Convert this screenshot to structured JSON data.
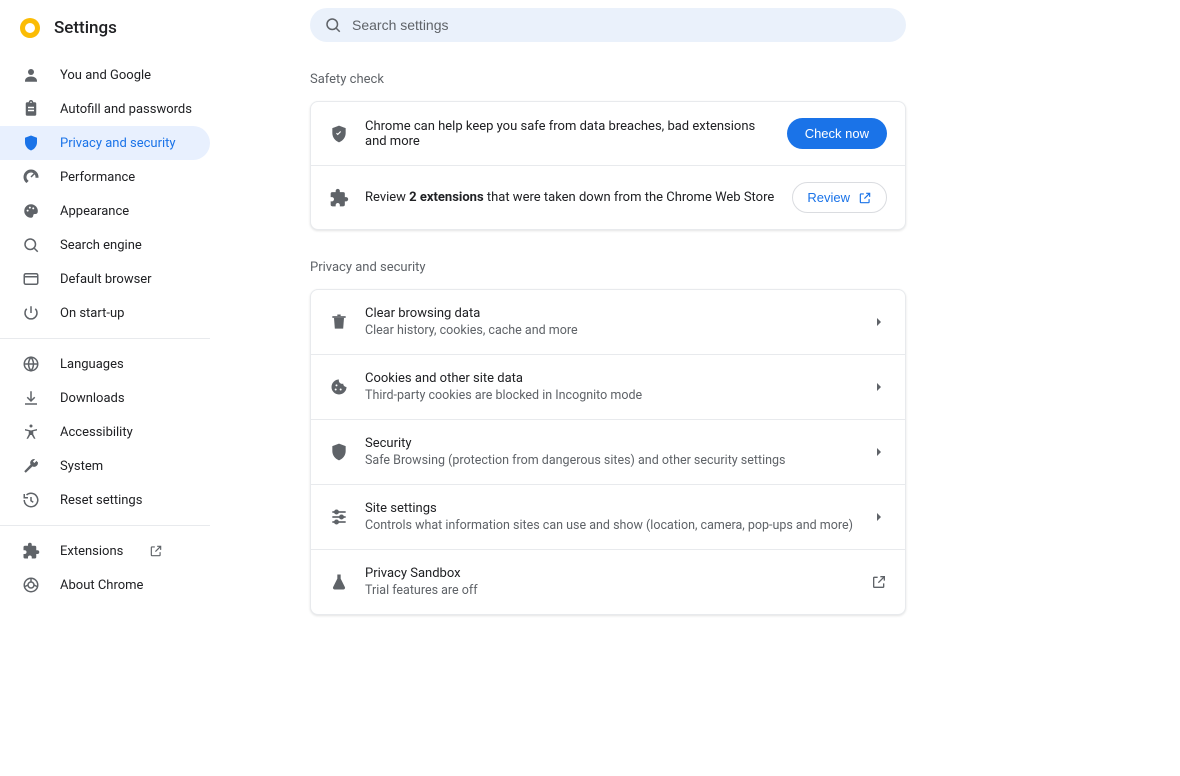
{
  "header": {
    "title": "Settings",
    "search_placeholder": "Search settings"
  },
  "sidebar": {
    "groups": [
      [
        {
          "id": "you",
          "label": "You and Google",
          "icon": "person-icon"
        },
        {
          "id": "autofill",
          "label": "Autofill and passwords",
          "icon": "assignment-icon"
        },
        {
          "id": "privacy",
          "label": "Privacy and security",
          "icon": "shield-icon",
          "active": true
        },
        {
          "id": "performance",
          "label": "Performance",
          "icon": "speed-icon"
        },
        {
          "id": "appearance",
          "label": "Appearance",
          "icon": "palette-icon"
        },
        {
          "id": "search",
          "label": "Search engine",
          "icon": "search-icon"
        },
        {
          "id": "defaultbrowser",
          "label": "Default browser",
          "icon": "window-icon"
        },
        {
          "id": "startup",
          "label": "On start-up",
          "icon": "power-icon"
        }
      ],
      [
        {
          "id": "languages",
          "label": "Languages",
          "icon": "globe-icon"
        },
        {
          "id": "downloads",
          "label": "Downloads",
          "icon": "download-icon"
        },
        {
          "id": "accessibility",
          "label": "Accessibility",
          "icon": "accessibility-icon"
        },
        {
          "id": "system",
          "label": "System",
          "icon": "wrench-icon"
        },
        {
          "id": "reset",
          "label": "Reset settings",
          "icon": "history-icon"
        }
      ],
      [
        {
          "id": "extensions",
          "label": "Extensions",
          "icon": "puzzle-icon",
          "external": true
        },
        {
          "id": "about",
          "label": "About Chrome",
          "icon": "chrome-icon"
        }
      ]
    ]
  },
  "safety_check": {
    "heading": "Safety check",
    "row1_text": "Chrome can help keep you safe from data breaches, bad extensions and more",
    "row1_button": "Check now",
    "row2_prefix": "Review ",
    "row2_bold": "2 extensions",
    "row2_suffix": " that were taken down from the Chrome Web Store",
    "row2_button": "Review"
  },
  "privacy_section": {
    "heading": "Privacy and security",
    "items": [
      {
        "id": "clear",
        "title": "Clear browsing data",
        "sub": "Clear history, cookies, cache and more",
        "icon": "trash-icon",
        "action": "arrow"
      },
      {
        "id": "cookies",
        "title": "Cookies and other site data",
        "sub": "Third-party cookies are blocked in Incognito mode",
        "icon": "cookie-icon",
        "action": "arrow"
      },
      {
        "id": "security",
        "title": "Security",
        "sub": "Safe Browsing (protection from dangerous sites) and other security settings",
        "icon": "shield-icon",
        "action": "arrow"
      },
      {
        "id": "site",
        "title": "Site settings",
        "sub": "Controls what information sites can use and show (location, camera, pop-ups and more)",
        "icon": "tune-icon",
        "action": "arrow"
      },
      {
        "id": "sandbox",
        "title": "Privacy Sandbox",
        "sub": "Trial features are off",
        "icon": "flask-icon",
        "action": "external"
      }
    ]
  }
}
